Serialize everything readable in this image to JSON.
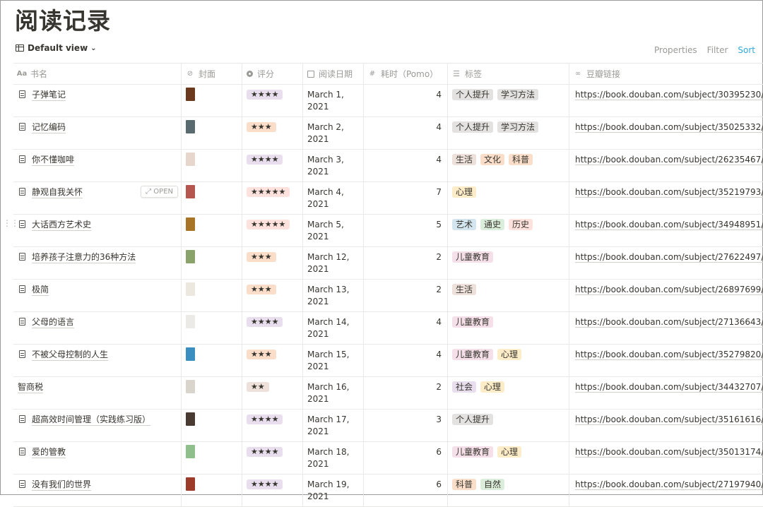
{
  "page": {
    "title": "阅读记录",
    "view_label": "Default view",
    "actions": {
      "properties": "Properties",
      "filter": "Filter",
      "sort": "Sort"
    }
  },
  "columns": {
    "name": "书名",
    "cover": "封面",
    "rating": "评分",
    "date": "阅读日期",
    "time": "耗时（Pomo）",
    "tags": "标签",
    "link": "豆瓣链接"
  },
  "open_label": "OPEN",
  "tag_colors": {
    "个人提升": "#e3e2e0",
    "学习方法": "#e3e2e0",
    "生活": "#eee0da",
    "文化": "#fadec9",
    "科普": "#fadec9",
    "心理": "#fdecc8",
    "艺术": "#d3e5ef",
    "通史": "#dbeddb",
    "历史": "#ffe2dd",
    "儿童教育": "#f5e0e9",
    "社会": "#e8deee",
    "自然": "#dbeddb"
  },
  "star_colors": {
    "★★": "#eee0da",
    "★★★": "#fadec9",
    "★★★★": "#e8deee",
    "★★★★★": "#ffe2dd"
  },
  "rows": [
    {
      "name": "子弹笔记",
      "icon": true,
      "cover": "#6b3a1e",
      "rating": "★★★★",
      "date": "March 1, 2021",
      "time": "4",
      "tags": [
        "个人提升",
        "学习方法"
      ],
      "link": "https://book.douban.com/subject/30395230/"
    },
    {
      "name": "记忆编码",
      "icon": true,
      "cover": "#5a6b70",
      "rating": "★★★",
      "date": "March 2, 2021",
      "time": "4",
      "tags": [
        "个人提升",
        "学习方法"
      ],
      "link": "https://book.douban.com/subject/35025332/"
    },
    {
      "name": "你不懂咖啡",
      "icon": true,
      "cover": "#e6d6cc",
      "rating": "★★★★",
      "date": "March 3, 2021",
      "time": "4",
      "tags": [
        "生活",
        "文化",
        "科普"
      ],
      "link": "https://book.douban.com/subject/26235467/"
    },
    {
      "name": "静观自我关怀",
      "icon": true,
      "cover": "#b5564f",
      "rating": "★★★★★",
      "date": "March 4, 2021",
      "time": "7",
      "tags": [
        "心理"
      ],
      "link": "https://book.douban.com/subject/35219793/",
      "open": true
    },
    {
      "name": "大话西方艺术史",
      "icon": true,
      "cover": "#a87426",
      "rating": "★★★★★",
      "date": "March 5, 2021",
      "time": "5",
      "tags": [
        "艺术",
        "通史",
        "历史"
      ],
      "link": "https://book.douban.com/subject/34948951/",
      "drag": true
    },
    {
      "name": "培养孩子注意力的36种方法",
      "icon": true,
      "cover": "#8aa36a",
      "rating": "★★★",
      "date": "March 12, 2021",
      "time": "2",
      "tags": [
        "儿童教育"
      ],
      "link": "https://book.douban.com/subject/27622497/"
    },
    {
      "name": "极简",
      "icon": true,
      "cover": "#ece7df",
      "rating": "★★★",
      "date": "March 13, 2021",
      "time": "2",
      "tags": [
        "生活"
      ],
      "link": "https://book.douban.com/subject/26897699/"
    },
    {
      "name": "父母的语言",
      "icon": true,
      "cover": "#eceae6",
      "rating": "★★★★",
      "date": "March 14, 2021",
      "time": "4",
      "tags": [
        "儿童教育"
      ],
      "link": "https://book.douban.com/subject/27136643/"
    },
    {
      "name": "不被父母控制的人生",
      "icon": true,
      "cover": "#3b8fc0",
      "rating": "★★★",
      "date": "March 15, 2021",
      "time": "4",
      "tags": [
        "儿童教育",
        "心理"
      ],
      "link": "https://book.douban.com/subject/35279820/"
    },
    {
      "name": "智商税",
      "icon": false,
      "cover": "#d9d4cc",
      "rating": "★★",
      "date": "March 16, 2021",
      "time": "2",
      "tags": [
        "社会",
        "心理"
      ],
      "link": "https://book.douban.com/subject/34432707/"
    },
    {
      "name": "超高效时间管理（实践练习版）",
      "icon": true,
      "cover": "#4a3b32",
      "rating": "★★★★",
      "date": "March 17, 2021",
      "time": "3",
      "tags": [
        "个人提升"
      ],
      "link": "https://book.douban.com/subject/35161616/"
    },
    {
      "name": "爱的管教",
      "icon": true,
      "cover": "#8fbf8a",
      "rating": "★★★★",
      "date": "March 18, 2021",
      "time": "6",
      "tags": [
        "儿童教育",
        "心理"
      ],
      "link": "https://book.douban.com/subject/35013174/"
    },
    {
      "name": "没有我们的世界",
      "icon": true,
      "cover": "#9c3b2a",
      "rating": "★★★★",
      "date": "March 19, 2021",
      "time": "6",
      "tags": [
        "科普",
        "自然"
      ],
      "link": "https://book.douban.com/subject/27197940/"
    }
  ]
}
